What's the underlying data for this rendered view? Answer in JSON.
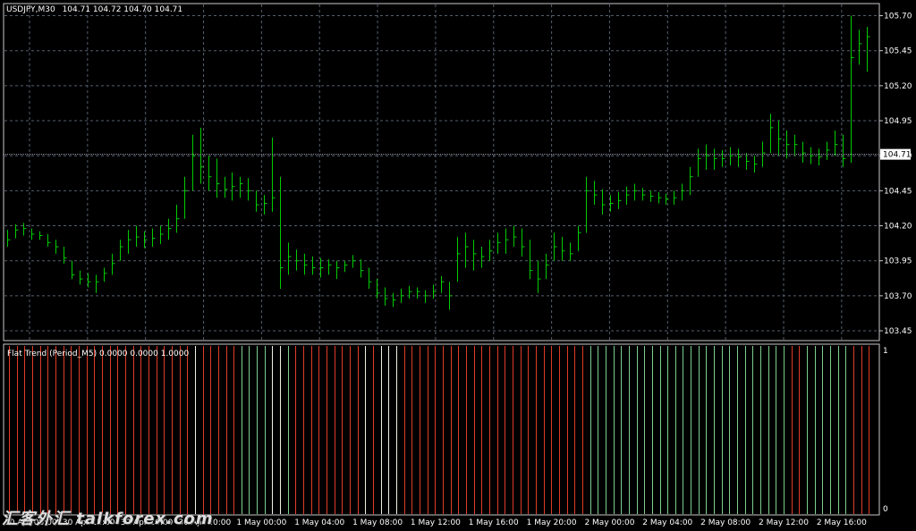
{
  "header": {
    "symbol_tf": "USDJPY,M30",
    "ohlc": "104.71 104.72 104.70 104.71"
  },
  "indicator": {
    "label": "Flat Trend (Period_M5) 0.0000 0.0000 1.0000",
    "scale_top": "1",
    "scale_bottom": "0"
  },
  "watermark": "汇客外汇 talkforex.com",
  "current_price_label": "104.71",
  "chart_data": [
    {
      "type": "ohlc_bar",
      "symbol": "USDJPY",
      "timeframe": "M30",
      "ylim": [
        103.38,
        105.78
      ],
      "y_ticks": [
        105.7,
        105.45,
        105.2,
        104.95,
        104.7,
        104.45,
        104.2,
        103.95,
        103.7,
        103.45
      ],
      "y_tick_labels": [
        "105.70",
        "105.45",
        "105.20",
        "104.95",
        "104.70",
        "104.45",
        "104.20",
        "103.95",
        "103.70",
        "103.45"
      ],
      "current_price": 104.71,
      "x_tick_labels": [
        "30 Apr 08:00",
        "30 Apr 12:00",
        "30 Apr 16:00",
        "30 Apr 20:00",
        "1 May 00:00",
        "1 May 04:00",
        "1 May 08:00",
        "1 May 12:00",
        "1 May 16:00",
        "1 May 20:00",
        "2 May 00:00",
        "2 May 04:00",
        "2 May 08:00",
        "2 May 12:00",
        "2 May 16:00"
      ],
      "bar_color": "#00cc00",
      "grid": true,
      "bars": [
        {
          "h": 104.17,
          "l": 104.05,
          "c": 104.1
        },
        {
          "h": 104.21,
          "l": 104.11,
          "c": 104.17
        },
        {
          "h": 104.22,
          "l": 104.13,
          "c": 104.18
        },
        {
          "h": 104.18,
          "l": 104.1,
          "c": 104.14
        },
        {
          "h": 104.16,
          "l": 104.1,
          "c": 104.13
        },
        {
          "h": 104.14,
          "l": 104.05,
          "c": 104.08
        },
        {
          "h": 104.1,
          "l": 104.0,
          "c": 104.05
        },
        {
          "h": 104.05,
          "l": 103.93,
          "c": 103.97
        },
        {
          "h": 103.95,
          "l": 103.82,
          "c": 103.85
        },
        {
          "h": 103.88,
          "l": 103.78,
          "c": 103.82
        },
        {
          "h": 103.86,
          "l": 103.76,
          "c": 103.8
        },
        {
          "h": 103.85,
          "l": 103.72,
          "c": 103.8
        },
        {
          "h": 103.9,
          "l": 103.8,
          "c": 103.86
        },
        {
          "h": 104.0,
          "l": 103.85,
          "c": 103.93
        },
        {
          "h": 104.1,
          "l": 103.95,
          "c": 104.05
        },
        {
          "h": 104.17,
          "l": 104.0,
          "c": 104.1
        },
        {
          "h": 104.2,
          "l": 104.05,
          "c": 104.12
        },
        {
          "h": 104.16,
          "l": 104.04,
          "c": 104.1
        },
        {
          "h": 104.18,
          "l": 104.05,
          "c": 104.11
        },
        {
          "h": 104.2,
          "l": 104.07,
          "c": 104.14
        },
        {
          "h": 104.25,
          "l": 104.1,
          "c": 104.18
        },
        {
          "h": 104.35,
          "l": 104.15,
          "c": 104.25
        },
        {
          "h": 104.55,
          "l": 104.25,
          "c": 104.45
        },
        {
          "h": 104.85,
          "l": 104.45,
          "c": 104.7
        },
        {
          "h": 104.9,
          "l": 104.5,
          "c": 104.62
        },
        {
          "h": 104.7,
          "l": 104.45,
          "c": 104.55
        },
        {
          "h": 104.68,
          "l": 104.4,
          "c": 104.5
        },
        {
          "h": 104.55,
          "l": 104.4,
          "c": 104.46
        },
        {
          "h": 104.58,
          "l": 104.38,
          "c": 104.48
        },
        {
          "h": 104.55,
          "l": 104.4,
          "c": 104.5
        },
        {
          "h": 104.54,
          "l": 104.38,
          "c": 104.45
        },
        {
          "h": 104.45,
          "l": 104.3,
          "c": 104.35
        },
        {
          "h": 104.42,
          "l": 104.28,
          "c": 104.36
        },
        {
          "h": 104.83,
          "l": 104.3,
          "c": 104.4
        },
        {
          "h": 104.55,
          "l": 103.75,
          "c": 103.9
        },
        {
          "h": 104.08,
          "l": 103.85,
          "c": 103.98
        },
        {
          "h": 104.03,
          "l": 103.88,
          "c": 103.95
        },
        {
          "h": 104.0,
          "l": 103.85,
          "c": 103.92
        },
        {
          "h": 103.98,
          "l": 103.85,
          "c": 103.9
        },
        {
          "h": 103.97,
          "l": 103.83,
          "c": 103.9
        },
        {
          "h": 103.96,
          "l": 103.85,
          "c": 103.92
        },
        {
          "h": 103.95,
          "l": 103.82,
          "c": 103.9
        },
        {
          "h": 103.95,
          "l": 103.87,
          "c": 103.92
        },
        {
          "h": 103.99,
          "l": 103.9,
          "c": 103.95
        },
        {
          "h": 103.96,
          "l": 103.83,
          "c": 103.88
        },
        {
          "h": 103.9,
          "l": 103.75,
          "c": 103.8
        },
        {
          "h": 103.82,
          "l": 103.68,
          "c": 103.72
        },
        {
          "h": 103.76,
          "l": 103.63,
          "c": 103.68
        },
        {
          "h": 103.72,
          "l": 103.62,
          "c": 103.67
        },
        {
          "h": 103.75,
          "l": 103.65,
          "c": 103.7
        },
        {
          "h": 103.77,
          "l": 103.68,
          "c": 103.73
        },
        {
          "h": 103.76,
          "l": 103.68,
          "c": 103.73
        },
        {
          "h": 103.74,
          "l": 103.65,
          "c": 103.7
        },
        {
          "h": 103.78,
          "l": 103.68,
          "c": 103.73
        },
        {
          "h": 103.84,
          "l": 103.72,
          "c": 103.8
        },
        {
          "h": 103.8,
          "l": 103.6,
          "c": 103.7
        },
        {
          "h": 104.12,
          "l": 103.8,
          "c": 104.0
        },
        {
          "h": 104.15,
          "l": 103.9,
          "c": 104.05
        },
        {
          "h": 104.1,
          "l": 103.88,
          "c": 104.0
        },
        {
          "h": 104.05,
          "l": 103.9,
          "c": 103.98
        },
        {
          "h": 104.1,
          "l": 103.95,
          "c": 104.02
        },
        {
          "h": 104.15,
          "l": 104.0,
          "c": 104.08
        },
        {
          "h": 104.18,
          "l": 104.0,
          "c": 104.1
        },
        {
          "h": 104.2,
          "l": 104.05,
          "c": 104.12
        },
        {
          "h": 104.18,
          "l": 103.98,
          "c": 104.05
        },
        {
          "h": 104.1,
          "l": 103.82,
          "c": 103.88
        },
        {
          "h": 103.95,
          "l": 103.72,
          "c": 103.82
        },
        {
          "h": 104.0,
          "l": 103.82,
          "c": 103.92
        },
        {
          "h": 104.15,
          "l": 103.95,
          "c": 104.05
        },
        {
          "h": 104.12,
          "l": 103.95,
          "c": 104.02
        },
        {
          "h": 104.08,
          "l": 103.95,
          "c": 104.0
        },
        {
          "h": 104.2,
          "l": 104.02,
          "c": 104.15
        },
        {
          "h": 104.55,
          "l": 104.15,
          "c": 104.45
        },
        {
          "h": 104.52,
          "l": 104.35,
          "c": 104.42
        },
        {
          "h": 104.46,
          "l": 104.28,
          "c": 104.35
        },
        {
          "h": 104.42,
          "l": 104.3,
          "c": 104.36
        },
        {
          "h": 104.44,
          "l": 104.32,
          "c": 104.38
        },
        {
          "h": 104.48,
          "l": 104.35,
          "c": 104.42
        },
        {
          "h": 104.5,
          "l": 104.38,
          "c": 104.45
        },
        {
          "h": 104.47,
          "l": 104.38,
          "c": 104.42
        },
        {
          "h": 104.45,
          "l": 104.37,
          "c": 104.41
        },
        {
          "h": 104.44,
          "l": 104.36,
          "c": 104.4
        },
        {
          "h": 104.43,
          "l": 104.35,
          "c": 104.39
        },
        {
          "h": 104.45,
          "l": 104.35,
          "c": 104.4
        },
        {
          "h": 104.5,
          "l": 104.38,
          "c": 104.45
        },
        {
          "h": 104.62,
          "l": 104.42,
          "c": 104.55
        },
        {
          "h": 104.75,
          "l": 104.55,
          "c": 104.68
        },
        {
          "h": 104.78,
          "l": 104.6,
          "c": 104.7
        },
        {
          "h": 104.75,
          "l": 104.6,
          "c": 104.68
        },
        {
          "h": 104.74,
          "l": 104.62,
          "c": 104.68
        },
        {
          "h": 104.76,
          "l": 104.63,
          "c": 104.7
        },
        {
          "h": 104.75,
          "l": 104.62,
          "c": 104.69
        },
        {
          "h": 104.72,
          "l": 104.6,
          "c": 104.66
        },
        {
          "h": 104.7,
          "l": 104.58,
          "c": 104.64
        },
        {
          "h": 104.8,
          "l": 104.62,
          "c": 104.72
        },
        {
          "h": 105.0,
          "l": 104.72,
          "c": 104.9
        },
        {
          "h": 104.95,
          "l": 104.7,
          "c": 104.82
        },
        {
          "h": 104.88,
          "l": 104.68,
          "c": 104.78
        },
        {
          "h": 104.85,
          "l": 104.7,
          "c": 104.78
        },
        {
          "h": 104.8,
          "l": 104.65,
          "c": 104.72
        },
        {
          "h": 104.76,
          "l": 104.64,
          "c": 104.7
        },
        {
          "h": 104.75,
          "l": 104.63,
          "c": 104.69
        },
        {
          "h": 104.8,
          "l": 104.67,
          "c": 104.74
        },
        {
          "h": 104.88,
          "l": 104.7,
          "c": 104.78
        },
        {
          "h": 104.85,
          "l": 104.62,
          "c": 104.68
        },
        {
          "h": 105.7,
          "l": 104.65,
          "c": 105.4
        },
        {
          "h": 105.6,
          "l": 105.35,
          "c": 105.5
        },
        {
          "h": 105.62,
          "l": 105.3,
          "c": 105.55
        }
      ]
    },
    {
      "type": "histogram",
      "name": "Flat Trend (Period_M5)",
      "ylim": [
        0,
        1
      ],
      "series": [
        {
          "color": "#e03c28",
          "values": [
            1,
            1,
            1,
            1,
            1,
            1,
            1,
            1,
            1,
            1,
            1,
            1,
            1,
            1,
            1,
            1,
            1,
            1,
            1,
            1,
            1,
            1,
            1,
            1,
            1,
            1,
            1,
            1,
            1,
            1,
            1,
            1,
            1,
            1,
            1,
            1,
            1,
            1,
            1,
            1,
            1,
            1,
            1,
            1,
            1,
            1,
            1,
            1,
            1,
            1,
            1,
            1,
            1,
            1,
            1,
            1,
            1,
            1,
            1,
            1,
            1,
            1,
            1,
            1,
            1,
            1,
            1,
            1,
            1,
            1,
            1,
            1,
            1,
            1,
            1,
            1,
            1,
            1,
            1,
            1,
            1,
            1,
            1,
            1,
            1,
            1,
            1,
            1,
            1,
            1,
            1,
            1,
            1,
            1,
            1,
            1,
            1,
            1,
            1,
            1,
            1,
            1,
            1,
            1,
            1,
            1,
            1,
            1,
            1,
            1,
            1,
            1
          ]
        }
      ],
      "bar_states": [
        "r",
        "r",
        "r",
        "r",
        "r",
        "r",
        "r",
        "r",
        "r",
        "r",
        "r",
        "r",
        "r",
        "r",
        "r",
        "r",
        "r",
        "r",
        "r",
        "r",
        "r",
        "r",
        "r",
        "r",
        "w",
        "r",
        "r",
        "r",
        "r",
        "r",
        "g",
        "g",
        "g",
        "g",
        "w",
        "w",
        "g",
        "r",
        "r",
        "r",
        "r",
        "r",
        "r",
        "r",
        "r",
        "r",
        "w",
        "r",
        "w",
        "w",
        "w",
        "r",
        "r",
        "r",
        "r",
        "r",
        "r",
        "r",
        "r",
        "r",
        "r",
        "r",
        "r",
        "r",
        "r",
        "r",
        "r",
        "r",
        "r",
        "r",
        "r",
        "r",
        "r",
        "r",
        "r",
        "g",
        "g",
        "g",
        "g",
        "g",
        "g",
        "g",
        "g",
        "g",
        "g",
        "g",
        "g",
        "g",
        "g",
        "g",
        "g",
        "g",
        "g",
        "g",
        "g",
        "g",
        "g",
        "g",
        "g",
        "g",
        "g",
        "r",
        "r",
        "g",
        "g",
        "g",
        "g",
        "g",
        "g",
        "r",
        "r",
        "r"
      ],
      "state_colors": {
        "r": "#e03c28",
        "g": "#7ecf8e",
        "w": "#f0f0e0"
      }
    }
  ]
}
